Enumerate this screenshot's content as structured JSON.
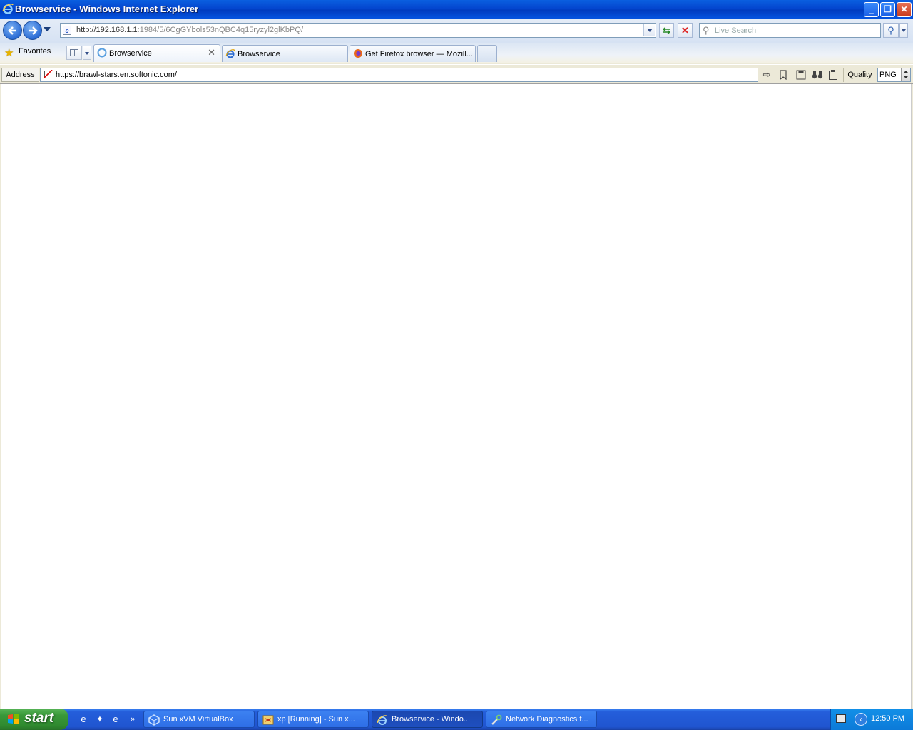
{
  "window": {
    "title": "Browservice - Windows Internet Explorer",
    "controls": {
      "minimize": "_",
      "restore": "❐",
      "close": "✕"
    }
  },
  "navbar": {
    "url_host": "http://192.168.1.1",
    "url_rest": ":1984/5/6CgGYbols53nQBC4q15ryzyl2glKbPQ/",
    "search_placeholder": "Live Search"
  },
  "tabbar": {
    "favorites_label": "Favorites",
    "tabs": [
      {
        "label": "Browservice",
        "icon": "loading-icon",
        "active": true
      },
      {
        "label": "Browservice",
        "icon": "ie-icon",
        "active": false
      },
      {
        "label": "Get Firefox browser — Mozill...",
        "icon": "firefox-icon",
        "active": false
      }
    ]
  },
  "addressbar": {
    "label": "Address",
    "value": "https://brawl-stars.en.softonic.com/",
    "quality_label": "Quality",
    "quality_value": "PNG"
  },
  "taskbar": {
    "start_label": "start",
    "buttons": [
      {
        "label": "Sun xVM VirtualBox",
        "icon": "virtualbox-icon",
        "active": false
      },
      {
        "label": "xp [Running] - Sun x...",
        "icon": "vm-running-icon",
        "active": false
      },
      {
        "label": "Browservice - Windo...",
        "icon": "ie-icon",
        "active": true
      },
      {
        "label": "Network Diagnostics f...",
        "icon": "network-diagnostics-icon",
        "active": false
      }
    ],
    "clock": "12:50 PM"
  },
  "colors": {
    "titlebar": "#0446cf",
    "taskbar": "#245edb",
    "start": "#3a993a",
    "page_bg": "#ffffff"
  }
}
